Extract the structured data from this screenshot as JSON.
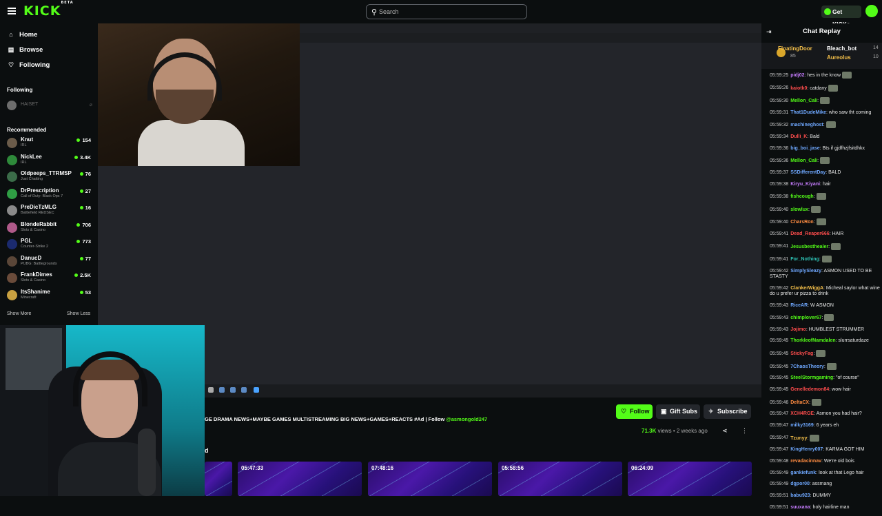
{
  "topbar": {
    "logo": "KICK",
    "logo_badge": "BETA",
    "search_placeholder": "Search",
    "get_kicks": "Get KICKs"
  },
  "sidebar": {
    "nav": [
      {
        "label": "Home",
        "icon": "home-icon"
      },
      {
        "label": "Browse",
        "icon": "browse-icon"
      },
      {
        "label": "Following",
        "icon": "heart-icon"
      }
    ],
    "following_heading": "Following",
    "following": [
      {
        "name": "HAISET"
      }
    ],
    "recommended_heading": "Recommended",
    "recommended": [
      {
        "name": "Knut",
        "category": "IRL",
        "viewers": "154",
        "color": "#6b5c4a"
      },
      {
        "name": "NickLee",
        "category": "IRL",
        "viewers": "3.4K",
        "color": "#2e8a3a"
      },
      {
        "name": "Oldpeeps_TTRMSP",
        "category": "Just Chatting",
        "viewers": "76",
        "color": "#3b6c49"
      },
      {
        "name": "DrPrescription",
        "category": "Call of Duty: Black Ops 7",
        "viewers": "27",
        "color": "#2f9e44"
      },
      {
        "name": "PreDicTzMLG",
        "category": "Battlefield REDSEC",
        "viewers": "16",
        "color": "#8a8a8a"
      },
      {
        "name": "BlondeRabbit",
        "category": "Slots & Casino",
        "viewers": "706",
        "color": "#b05a8a"
      },
      {
        "name": "PGL",
        "category": "Counter-Strike 2",
        "viewers": "773",
        "color": "#1b2a6e"
      },
      {
        "name": "DanucD",
        "category": "PUBG: Battlegrounds",
        "viewers": "77",
        "color": "#5a4638"
      },
      {
        "name": "FrankDimes",
        "category": "Slots & Casino",
        "viewers": "2.5K",
        "color": "#6a4b3a"
      },
      {
        "name": "ItsShanime",
        "category": "Minecraft",
        "viewers": "53",
        "color": "#c8a040"
      }
    ],
    "show_more": "Show More",
    "show_less": "Show Less"
  },
  "stream": {
    "title": "GE DRAMA NEWS+MAYBE GAMES MULTISTREAMING BIG NEWS+GAMES+REACTS #Ad | Follow ",
    "title_tag": "@asmongold247",
    "follow": "Follow",
    "gift_subs": "Gift Subs",
    "subscribe": "Subscribe",
    "views": "71.3K",
    "views_label": " views",
    "separator": " • ",
    "age": "2 weeks ago",
    "section_letter": "d",
    "vods": [
      {
        "duration": ""
      },
      {
        "duration": "05:47:33"
      },
      {
        "duration": "07:48:16"
      },
      {
        "duration": "05:58:56"
      },
      {
        "duration": "06:24:09"
      }
    ]
  },
  "chat": {
    "heading": "Chat Replay",
    "pinned": {
      "user1": "FloatingDoor",
      "user1_count": "85",
      "user2": "Bleach_bot",
      "user2_count": "14",
      "user3": "Aureolus",
      "user3_count": "10"
    },
    "messages": [
      {
        "time": "05:59:25",
        "user": "pidj02",
        "color": "#c77dff",
        "text": " hes in the know",
        "emote": true
      },
      {
        "time": "05:59:26",
        "user": "kaiotk0",
        "color": "#ff4d4d",
        "text": " catdany",
        "emote": true
      },
      {
        "time": "05:59:30",
        "user": "Mellon_Cali",
        "color": "#53fc18",
        "text": "",
        "emote": true
      },
      {
        "time": "05:59:31",
        "user": "That1DudeMike",
        "color": "#6fa8ff",
        "text": " who saw tht coming",
        "emote": false
      },
      {
        "time": "05:59:32",
        "user": "machineghost",
        "color": "#6fa8ff",
        "text": "",
        "emote": true
      },
      {
        "time": "05:59:34",
        "user": "Dulli_K",
        "color": "#ff4d4d",
        "text": " Bald",
        "emote": false
      },
      {
        "time": "05:59:36",
        "user": "big_boi_jase",
        "color": "#6fa8ff",
        "text": " Bts if gjdfhzjfsitdhkx",
        "emote": false
      },
      {
        "time": "05:59:36",
        "user": "Mellon_Cali",
        "color": "#53fc18",
        "text": "",
        "emote": true
      },
      {
        "time": "05:59:37",
        "user": "SSDifferentDay",
        "color": "#6fa8ff",
        "text": " BALD",
        "emote": false
      },
      {
        "time": "05:59:38",
        "user": "Kiryu_Kiyani",
        "color": "#c77dff",
        "text": " hair",
        "emote": false
      },
      {
        "time": "05:59:38",
        "user": "fishcough",
        "color": "#53fc18",
        "text": "",
        "emote": true
      },
      {
        "time": "05:59:40",
        "user": "slowlux",
        "color": "#53fc18",
        "text": "",
        "emote": true
      },
      {
        "time": "05:59:40",
        "user": "CharsRon",
        "color": "#ff8c42",
        "text": "",
        "emote": true
      },
      {
        "time": "05:59:41",
        "user": "Dead_Reaper666",
        "color": "#ff4d4d",
        "text": " HAIR",
        "emote": false
      },
      {
        "time": "05:59:41",
        "user": "Jesusbesthealer",
        "color": "#53fc18",
        "text": "",
        "emote": true
      },
      {
        "time": "05:59:41",
        "user": "For_Nothing",
        "color": "#2ec4b6",
        "text": "",
        "emote": true
      },
      {
        "time": "05:59:42",
        "user": "SimplySleazy",
        "color": "#6fa8ff",
        "text": " ASMON USED TO BE STASTY",
        "emote": false
      },
      {
        "time": "05:59:42",
        "user": "ClankerWiggA",
        "color": "#f5c04a",
        "text": " Micheal saylor what wine do u prefer ur pizza to drink",
        "emote": false
      },
      {
        "time": "05:59:43",
        "user": "RiceAR",
        "color": "#6fa8ff",
        "text": " W ASMON",
        "emote": false
      },
      {
        "time": "05:59:43",
        "user": "chimplover67",
        "color": "#53fc18",
        "text": "",
        "emote": true
      },
      {
        "time": "05:59:43",
        "user": "Jojimo",
        "color": "#ff4d4d",
        "text": " HUMBLEST STRUMMER",
        "emote": false
      },
      {
        "time": "05:59:45",
        "user": "ThorkleofNamdalen",
        "color": "#53fc18",
        "text": " slurrsaturdaze",
        "emote": false
      },
      {
        "time": "05:59:45",
        "user": "StickyFag",
        "color": "#ff4d4d",
        "text": "",
        "emote": true
      },
      {
        "time": "05:59:45",
        "user": "7ChaosTheory",
        "color": "#6fa8ff",
        "text": "",
        "emote": true
      },
      {
        "time": "05:59:45",
        "user": "SteelStormgaming",
        "color": "#53fc18",
        "text": " \"of course\"",
        "emote": false
      },
      {
        "time": "05:59:45",
        "user": "Genelledemon84",
        "color": "#ff4d4d",
        "text": " wow hair",
        "emote": false
      },
      {
        "time": "05:59:46",
        "user": "DeltaCX",
        "color": "#ff8c42",
        "text": "",
        "emote": true
      },
      {
        "time": "05:59:47",
        "user": "XCH4RGE",
        "color": "#ff4d4d",
        "text": " Asmon you had hair?",
        "emote": false
      },
      {
        "time": "05:59:47",
        "user": "milky3169",
        "color": "#6fa8ff",
        "text": " 6 years eh",
        "emote": false
      },
      {
        "time": "05:59:47",
        "user": "Tzunyy",
        "color": "#f5c04a",
        "text": "",
        "emote": true
      },
      {
        "time": "05:59:47",
        "user": "KingHenry007",
        "color": "#6fa8ff",
        "text": " KARMA GOT HIM",
        "emote": false
      },
      {
        "time": "05:59:48",
        "user": "revadacinnav",
        "color": "#ff8c42",
        "text": " We're old bois",
        "emote": false
      },
      {
        "time": "05:59:49",
        "user": "gankiefunk",
        "color": "#6fa8ff",
        "text": " look at that Lego hair",
        "emote": false
      },
      {
        "time": "05:59:49",
        "user": "dgpor00",
        "color": "#6fa8ff",
        "text": " assmang",
        "emote": false
      },
      {
        "time": "05:59:51",
        "user": "babu923",
        "color": "#6fa8ff",
        "text": " DUMMY",
        "emote": false
      },
      {
        "time": "05:59:51",
        "user": "suuxana",
        "color": "#c77dff",
        "text": " holy hairline man",
        "emote": false
      }
    ]
  },
  "colors": {
    "brand": "#53fc18",
    "bg": "#0b0e0f",
    "video_bg": "#23252a"
  }
}
